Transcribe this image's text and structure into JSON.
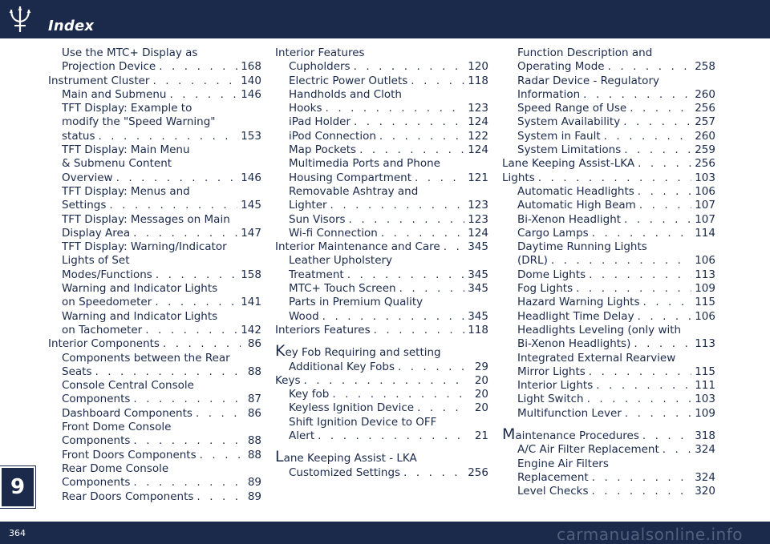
{
  "header": {
    "title": "Index"
  },
  "chapter_tab": "9",
  "footer": {
    "page_number": "364",
    "watermark": "carmanualsonline.info"
  },
  "columns": [
    [
      {
        "text": "Use the MTC+ Display as",
        "level": 1
      },
      {
        "text": "Projection Device",
        "page": "168",
        "level": 1
      },
      {
        "text": "Instrument Cluster",
        "page": "140",
        "level": 0
      },
      {
        "text": "Main and Submenu",
        "page": "146",
        "level": 1
      },
      {
        "text": "TFT Display: Example to",
        "level": 1
      },
      {
        "text": "modify the \"Speed Warning\"",
        "level": 1
      },
      {
        "text": "status",
        "page": "153",
        "level": 1
      },
      {
        "text": "TFT Display: Main Menu",
        "level": 1
      },
      {
        "text": "& Submenu Content",
        "level": 1
      },
      {
        "text": "Overview",
        "page": "146",
        "level": 1
      },
      {
        "text": "TFT Display: Menus and",
        "level": 1
      },
      {
        "text": "Settings",
        "page": "145",
        "level": 1
      },
      {
        "text": "TFT Display: Messages on Main",
        "level": 1
      },
      {
        "text": "Display Area",
        "page": "147",
        "level": 1
      },
      {
        "text": "TFT Display: Warning/Indicator",
        "level": 1
      },
      {
        "text": "Lights of Set",
        "level": 1
      },
      {
        "text": "Modes/Functions",
        "page": "158",
        "level": 1
      },
      {
        "text": "Warning and Indicator Lights",
        "level": 1
      },
      {
        "text": "on Speedometer",
        "page": "141",
        "level": 1
      },
      {
        "text": "Warning and Indicator Lights",
        "level": 1
      },
      {
        "text": "on Tachometer",
        "page": "142",
        "level": 1
      },
      {
        "text": "Interior Components",
        "page": "86",
        "level": 0
      },
      {
        "text": "Components between the Rear",
        "level": 1
      },
      {
        "text": "Seats",
        "page": "88",
        "level": 1
      },
      {
        "text": "Console Central Console",
        "level": 1
      },
      {
        "text": "Components",
        "page": "87",
        "level": 1
      },
      {
        "text": "Dashboard Components",
        "page": "86",
        "level": 1
      },
      {
        "text": "Front Dome Console",
        "level": 1
      },
      {
        "text": "Components",
        "page": "88",
        "level": 1
      },
      {
        "text": "Front Doors Components",
        "page": "88",
        "level": 1
      },
      {
        "text": "Rear Dome Console",
        "level": 1
      },
      {
        "text": "Components",
        "page": "89",
        "level": 1
      },
      {
        "text": "Rear Doors Components",
        "page": "89",
        "level": 1
      }
    ],
    [
      {
        "text": "Interior Features",
        "level": 0
      },
      {
        "text": "Cupholders",
        "page": "120",
        "level": 1
      },
      {
        "text": "Electric Power Outlets",
        "page": "118",
        "level": 1
      },
      {
        "text": "Handholds and Cloth",
        "level": 1
      },
      {
        "text": "Hooks",
        "page": "123",
        "level": 1
      },
      {
        "text": "iPad Holder",
        "page": "124",
        "level": 1
      },
      {
        "text": "iPod Connection",
        "page": "122",
        "level": 1
      },
      {
        "text": "Map Pockets",
        "page": "124",
        "level": 1
      },
      {
        "text": "Multimedia Ports and Phone",
        "level": 1
      },
      {
        "text": "Housing Compartment",
        "page": "121",
        "level": 1
      },
      {
        "text": "Removable Ashtray and",
        "level": 1
      },
      {
        "text": "Lighter",
        "page": "123",
        "level": 1
      },
      {
        "text": "Sun Visors",
        "page": "123",
        "level": 1
      },
      {
        "text": "Wi-fi Connection",
        "page": "124",
        "level": 1
      },
      {
        "text": "Interior Maintenance and Care",
        "page": "345",
        "level": 0
      },
      {
        "text": "Leather Upholstery",
        "level": 1
      },
      {
        "text": "Treatment",
        "page": "345",
        "level": 1
      },
      {
        "text": "MTC+ Touch Screen",
        "page": "345",
        "level": 1
      },
      {
        "text": "Parts in Premium Quality",
        "level": 1
      },
      {
        "text": "Wood",
        "page": "345",
        "level": 1
      },
      {
        "text": "Interiors Features",
        "page": "118",
        "level": 0
      },
      {
        "initial": "K",
        "text": "ey Fob Requiring and setting",
        "level": 0,
        "letter": true
      },
      {
        "text": "Additional Key Fobs",
        "page": "29",
        "level": 1
      },
      {
        "text": "Keys",
        "page": "20",
        "level": 0
      },
      {
        "text": "Key fob",
        "page": "20",
        "level": 1
      },
      {
        "text": "Keyless Ignition Device",
        "page": "20",
        "level": 1
      },
      {
        "text": "Shift Ignition Device to OFF",
        "level": 1
      },
      {
        "text": "Alert",
        "page": "21",
        "level": 1
      },
      {
        "initial": "L",
        "text": "ane Keeping Assist - LKA",
        "level": 0,
        "letter": true
      },
      {
        "text": "Customized Settings",
        "page": "256",
        "level": 1
      }
    ],
    [
      {
        "text": "Function Description and",
        "level": 2
      },
      {
        "text": "Operating Mode",
        "page": "258",
        "level": 2
      },
      {
        "text": "Radar Device - Regulatory",
        "level": 2
      },
      {
        "text": "Information",
        "page": "260",
        "level": 2
      },
      {
        "text": "Speed Range of Use",
        "page": "256",
        "level": 2
      },
      {
        "text": "System Availability",
        "page": "257",
        "level": 2
      },
      {
        "text": "System in Fault",
        "page": "260",
        "level": 2
      },
      {
        "text": "System Limitations",
        "page": "259",
        "level": 2
      },
      {
        "text": "Lane Keeping Assist-LKA",
        "page": "256",
        "level": 0
      },
      {
        "text": "Lights",
        "page": "103",
        "level": 0
      },
      {
        "text": "Automatic Headlights",
        "page": "106",
        "level": 2
      },
      {
        "text": "Automatic High Beam",
        "page": "107",
        "level": 2
      },
      {
        "text": "Bi-Xenon Headlight",
        "page": "107",
        "level": 2
      },
      {
        "text": "Cargo Lamps",
        "page": "114",
        "level": 2
      },
      {
        "text": "Daytime Running Lights",
        "level": 2
      },
      {
        "text": "(DRL)",
        "page": "106",
        "level": 2
      },
      {
        "text": "Dome Lights",
        "page": "113",
        "level": 2
      },
      {
        "text": "Fog Lights",
        "page": "109",
        "level": 2
      },
      {
        "text": "Hazard Warning Lights",
        "page": "115",
        "level": 2
      },
      {
        "text": "Headlight Time Delay",
        "page": "106",
        "level": 2
      },
      {
        "text": "Headlights Leveling (only with",
        "level": 2
      },
      {
        "text": "Bi-Xenon Headlights)",
        "page": "113",
        "level": 2
      },
      {
        "text": "Integrated External Rearview",
        "level": 2
      },
      {
        "text": "Mirror Lights",
        "page": "115",
        "level": 2
      },
      {
        "text": "Interior Lights",
        "page": "111",
        "level": 2
      },
      {
        "text": "Light Switch",
        "page": "103",
        "level": 2
      },
      {
        "text": "Multifunction Lever",
        "page": "109",
        "level": 2
      },
      {
        "initial": "M",
        "text": "aintenance Procedures",
        "page": "318",
        "level": 0,
        "letter": true
      },
      {
        "text": "A/C Air Filter Replacement",
        "page": "324",
        "level": 2
      },
      {
        "text": "Engine Air Filters",
        "level": 2
      },
      {
        "text": "Replacement",
        "page": "324",
        "level": 2
      },
      {
        "text": "Level Checks",
        "page": "320",
        "level": 2
      }
    ]
  ]
}
